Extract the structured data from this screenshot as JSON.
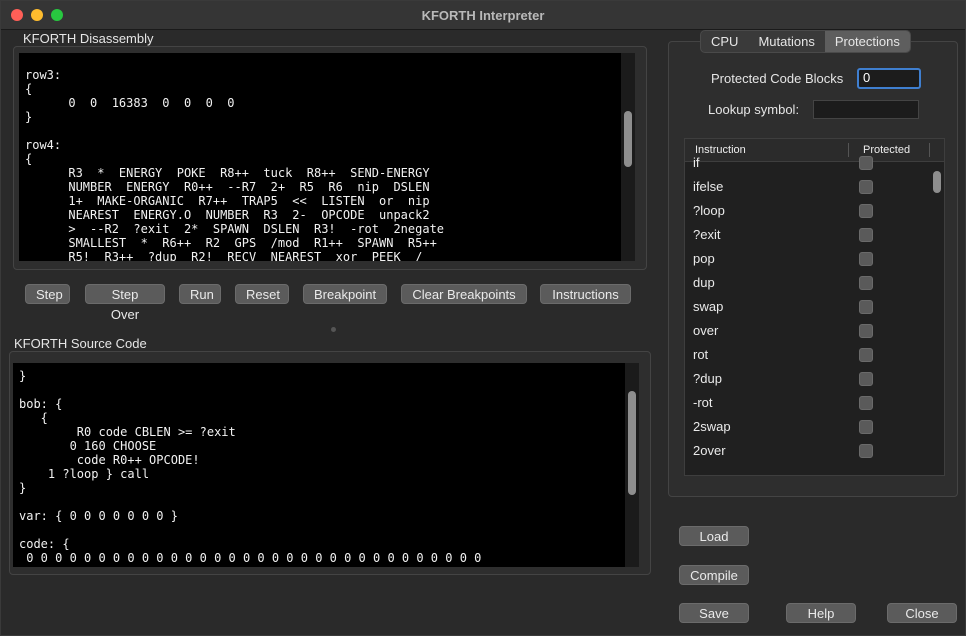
{
  "window": {
    "title": "KFORTH Interpreter"
  },
  "disassembly": {
    "label": "KFORTH Disassembly",
    "code": "row3:\n{\n      0  0  16383  0  0  0  0\n}\n\nrow4:\n{\n      R3  *  ENERGY  POKE  R8++  tuck  R8++  SEND-ENERGY\n      NUMBER  ENERGY  R0++  --R7  2+  R5  R6  nip  DSLEN\n      1+  MAKE-ORGANIC  R7++  TRAP5  <<  LISTEN  or  nip\n      NEAREST  ENERGY.O  NUMBER  R3  2-  OPCODE  unpack2\n      >  --R2  ?exit  2*  SPAWN  DSLEN  R3!  -rot  2negate\n      SMALLEST  *  R6++  R2  GPS  /mod  R1++  SPAWN  R5++\n      R5!  R3++  ?dup  R2!  RECV  NEAREST  xor  PEEK  /"
  },
  "toolbar": {
    "step": "Step",
    "step_over": "Step Over",
    "run": "Run",
    "reset": "Reset",
    "breakpoint": "Breakpoint",
    "clear_breakpoints": "Clear Breakpoints",
    "instructions": "Instructions"
  },
  "source": {
    "label": "KFORTH Source Code",
    "code": "}\n\nbob: {\n   {\n        R0 code CBLEN >= ?exit\n       0 160 CHOOSE\n        code R0++ OPCODE!\n    1 ?loop } call\n}\n\nvar: { 0 0 0 0 0 0 0 }\n\ncode: {\n 0 0 0 0 0 0 0 0 0 0 0 0 0 0 0 0 0 0 0 0 0 0 0 0 0 0 0 0 0 0 0 0"
  },
  "tabs": [
    "CPU",
    "Mutations",
    "Protections"
  ],
  "protections": {
    "blocks_label": "Protected Code Blocks",
    "blocks_value": "0",
    "lookup_label": "Lookup symbol:",
    "lookup_value": "",
    "col_instruction": "Instruction",
    "col_protected": "Protected",
    "rows": [
      "if",
      "ifelse",
      "?loop",
      "?exit",
      "pop",
      "dup",
      "swap",
      "over",
      "rot",
      "?dup",
      "-rot",
      "2swap",
      "2over"
    ]
  },
  "buttons": {
    "load": "Load",
    "compile": "Compile",
    "save": "Save",
    "help": "Help",
    "close": "Close"
  }
}
